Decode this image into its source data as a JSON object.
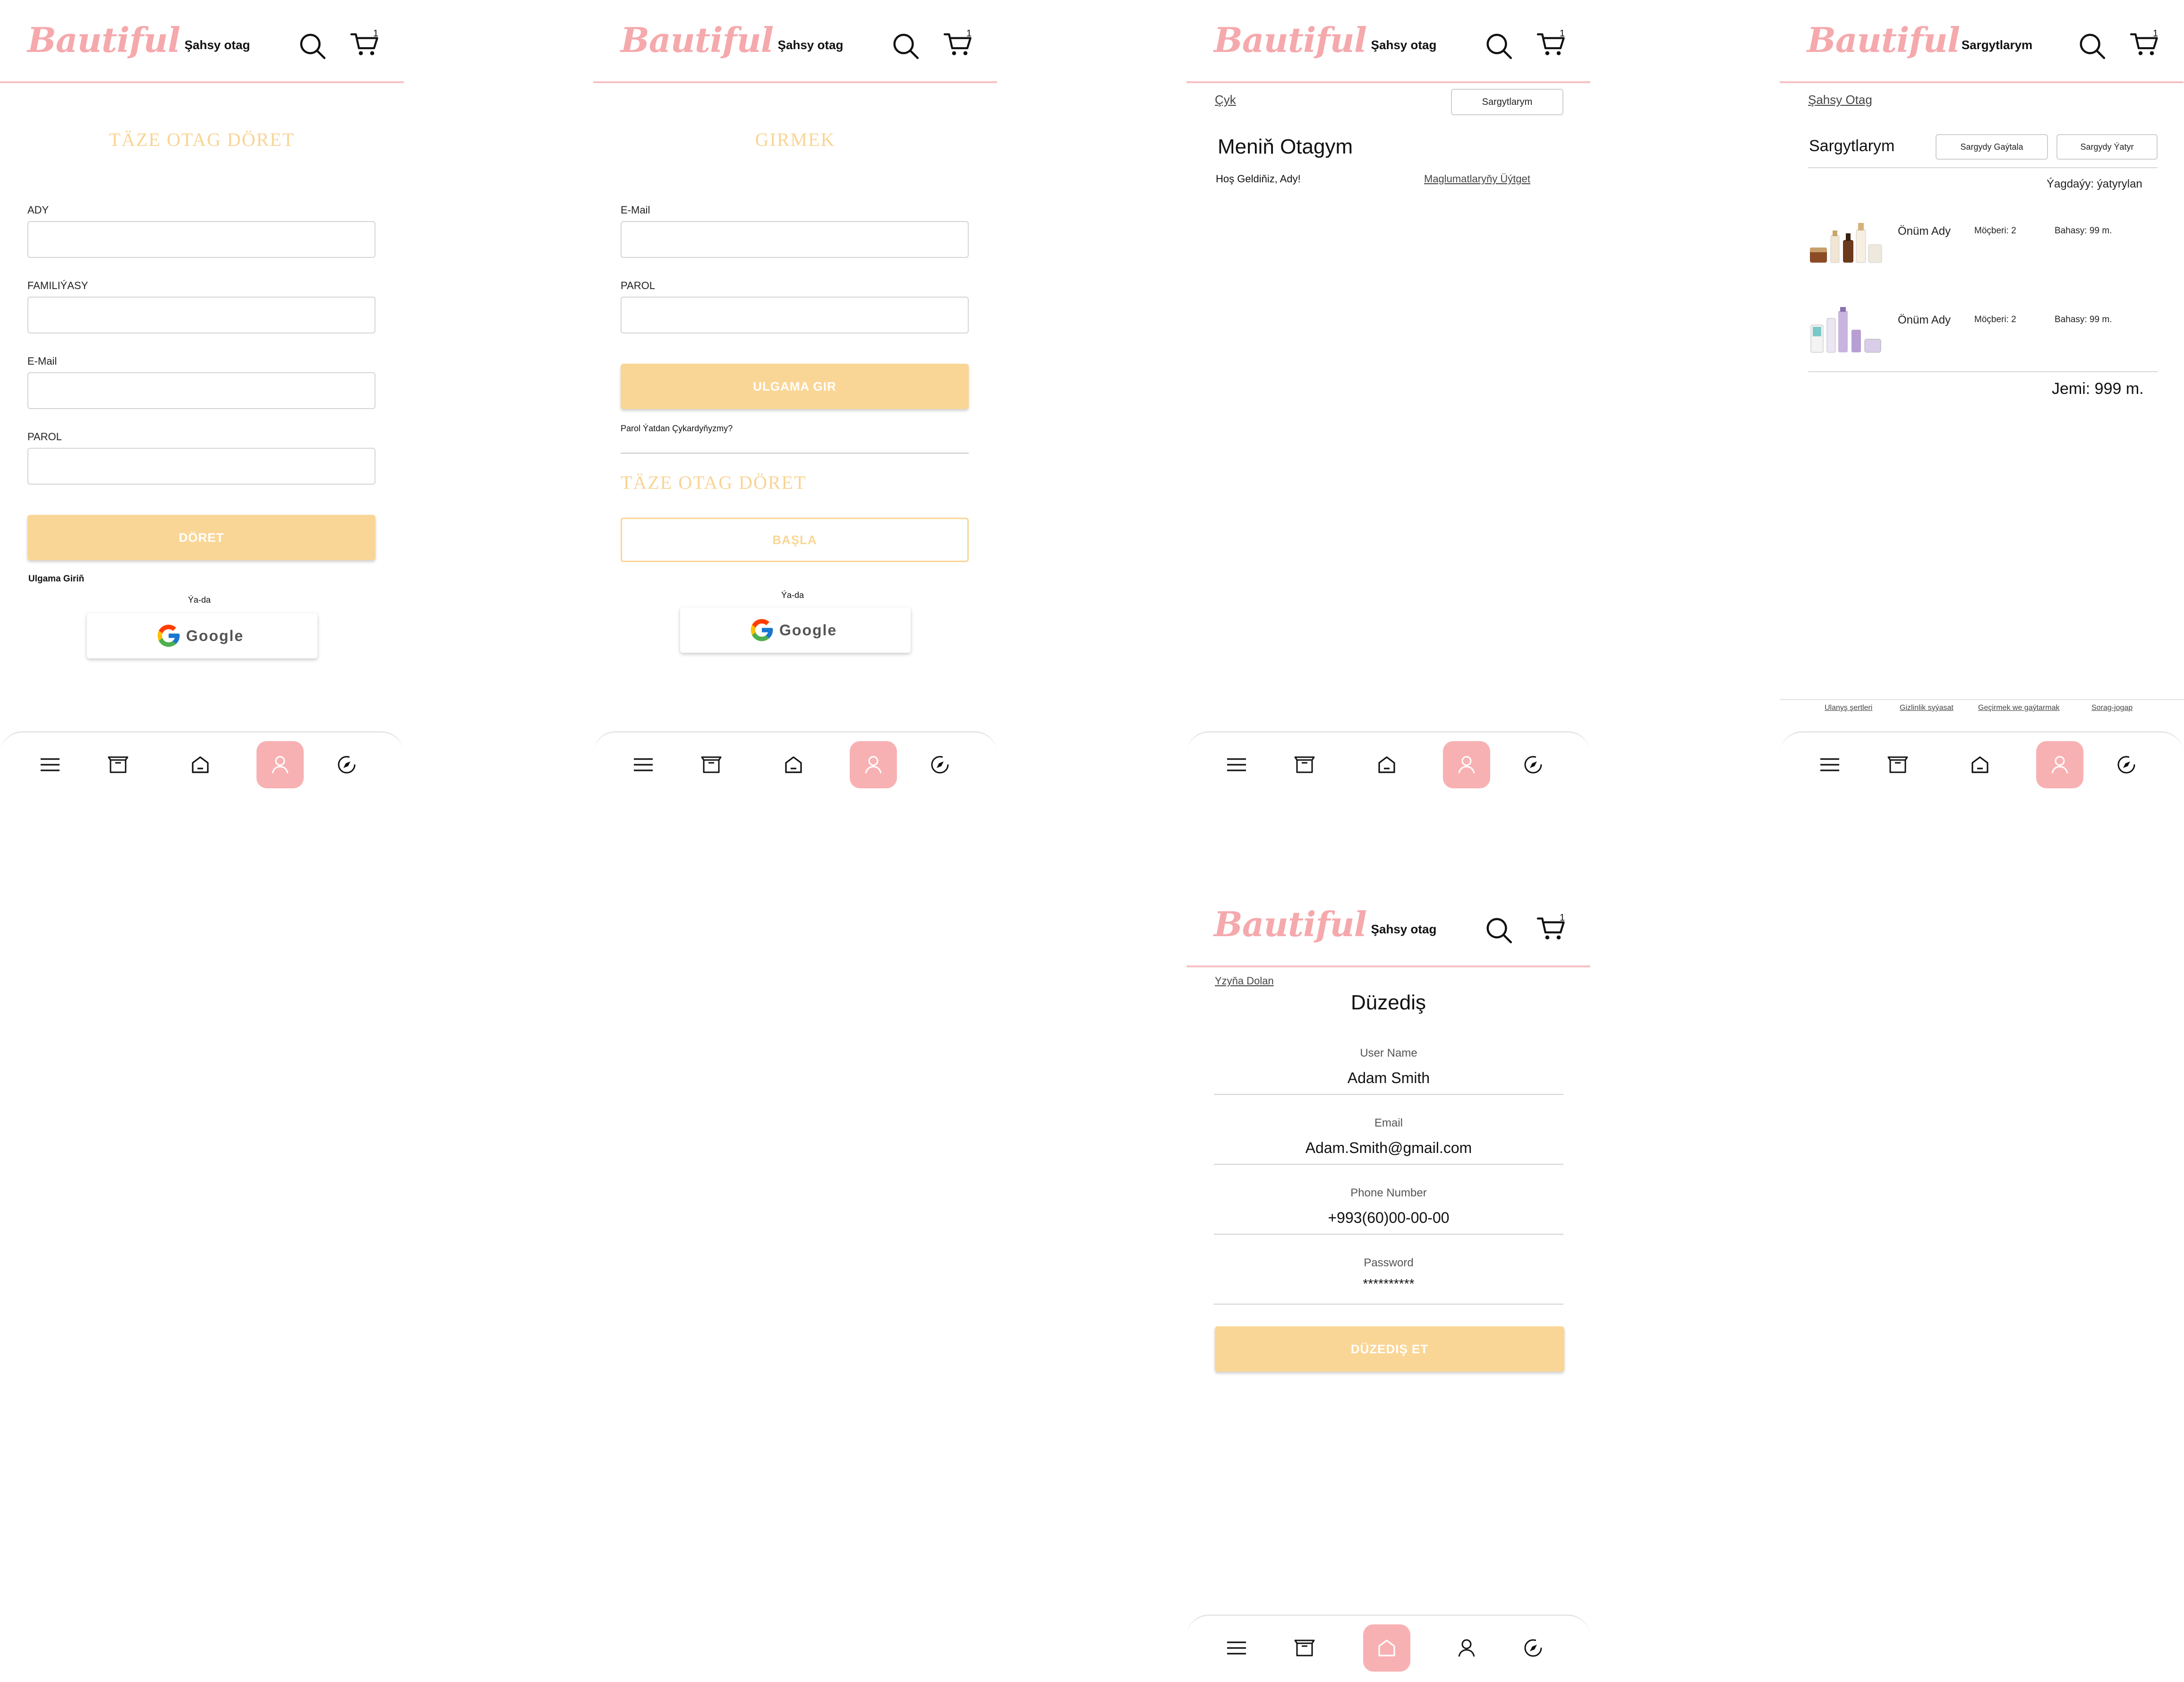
{
  "brand": {
    "logo": "Bautiful",
    "pink": "#f5a9ac",
    "yellow": "#fad696"
  },
  "header": {
    "personal_title": "Şahsy otag",
    "orders_title": "Sargytlarym",
    "cart_count": "1"
  },
  "register": {
    "heading": "TÄZE OTAG DÖRET",
    "labels": [
      "ADY",
      "FAMILIÝASY",
      "E-Mail",
      "PAROL"
    ],
    "submit": "DÖRET",
    "login_link": "Ulgama Giriň",
    "or": "Ýa-da",
    "google": "Google"
  },
  "login": {
    "heading": "GIRMEK",
    "labels": [
      "E-Mail",
      "PAROL"
    ],
    "submit": "ULGAMA GIR",
    "forgot": "Parol Ýatdan Çykardyňyzmy?",
    "create_heading": "TÄZE OTAG DÖRET",
    "start": "BAŞLA",
    "or": "Ýa-da",
    "google": "Google"
  },
  "account": {
    "logout": "Çyk",
    "orders_button": "Sargytlarym",
    "title": "Meniň Otagym",
    "welcome": "Hoş Geldiňiz, Ady!",
    "edit_link": "Maglumatlaryňy Üýtget"
  },
  "orders": {
    "back": "Şahsy Otag",
    "title": "Sargytlarym",
    "repeat_button": "Sargydy Gaýtala",
    "cancel_button": "Sargydy Ýatyr",
    "status": "Ýagdaýy: ýatyrylan",
    "items": [
      {
        "name": "Önüm Ady",
        "qty": "Möçberi: 2",
        "price": "Bahasy: 99 m."
      },
      {
        "name": "Önüm Ady",
        "qty": "Möçberi: 2",
        "price": "Bahasy: 99 m."
      }
    ],
    "total": "Jemi: 999 m.",
    "footer": [
      "Ulanyş şertleri",
      "Gizlinlik syýasat",
      "Geçirmek we gaýtarmak",
      "Sorag-jogap"
    ]
  },
  "edit": {
    "back": "Yzyňa Dolan",
    "title": "Düzediş",
    "fields": [
      {
        "label": "User Name",
        "value": "Adam Smith"
      },
      {
        "label": "Email",
        "value": "Adam.Smith@gmail.com"
      },
      {
        "label": "Phone Number",
        "value": "+993(60)00-00-00"
      },
      {
        "label": "Password",
        "value": "**********"
      }
    ],
    "submit": "DÜZEDIŞ ET"
  },
  "nav": {
    "items": [
      "menu-icon",
      "box-icon",
      "home-icon",
      "user-icon",
      "compass-icon"
    ],
    "active_profile": "user-icon",
    "active_edit": "home-icon"
  }
}
